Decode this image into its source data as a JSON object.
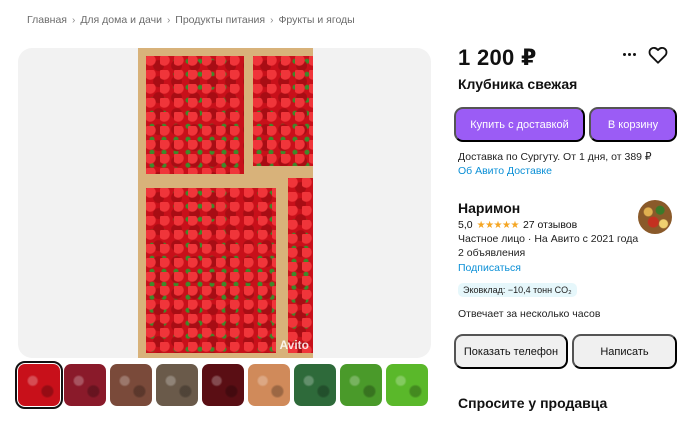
{
  "breadcrumb": {
    "items": [
      "Главная",
      "Для дома и дачи",
      "Продукты питания",
      "Фрукты и ягоды"
    ],
    "separator": "›"
  },
  "gallery": {
    "watermark": "Avito",
    "thumbnails": [
      {
        "name": "strawberries-crate",
        "color": "#c8101a"
      },
      {
        "name": "berries-bowl",
        "color": "#8a1a2a"
      },
      {
        "name": "market-stall",
        "color": "#7a4a3a"
      },
      {
        "name": "boxes-produce",
        "color": "#6a5a4a"
      },
      {
        "name": "cherries",
        "color": "#5a0e14"
      },
      {
        "name": "eggs",
        "color": "#d08a5a"
      },
      {
        "name": "cucumbers",
        "color": "#2e6a3a"
      },
      {
        "name": "green-peas",
        "color": "#4a9a2a"
      },
      {
        "name": "green-peppers",
        "color": "#5ab82a"
      }
    ]
  },
  "product": {
    "price": "1 200 ₽",
    "title": "Клубника свежая"
  },
  "actions": {
    "buy_label": "Купить с доставкой",
    "cart_label": "В корзину",
    "accent_color": "#9b5cf5"
  },
  "delivery": {
    "text": "Доставка по Сургуту. От 1 дня, от 389 ₽",
    "link": "Об Авито Доставке"
  },
  "seller": {
    "name": "Наримон",
    "rating": "5,0",
    "stars": "★★★★★",
    "reviews": "27 отзывов",
    "info": "Частное лицо · На Авито с 2021 года",
    "ads": "2 объявления",
    "subscribe": "Подписаться",
    "eco": "Эковклад: −10,4 тонн CO₂",
    "response": "Отвечает за несколько часов",
    "phone_label": "Показать телефон",
    "write_label": "Написать"
  },
  "ask": {
    "title": "Спросите у продавца"
  }
}
